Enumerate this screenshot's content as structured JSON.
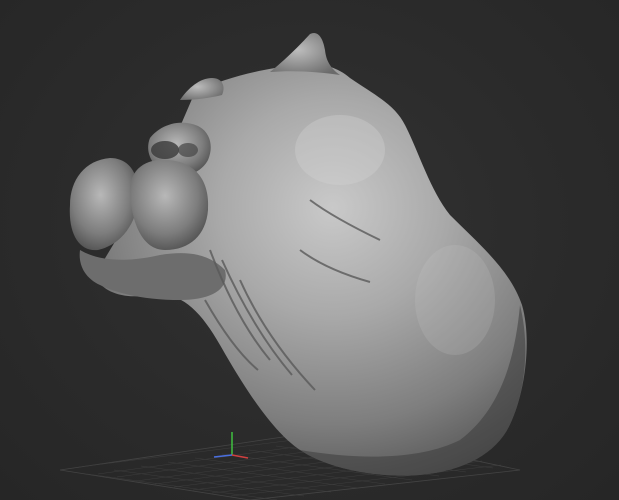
{
  "viewport": {
    "background_color": "#2b2b2b",
    "mesh_color": "#9a9a9a",
    "grid_color": "#5a5a5a",
    "axis_colors": {
      "x": "#d04040",
      "y": "#3fbf3f",
      "z": "#4a6fe0"
    },
    "model": "sculpted-creature-head",
    "icons": {
      "floor_grid": "floor-grid-icon",
      "axis_gizmo": "axis-gizmo-icon"
    }
  }
}
